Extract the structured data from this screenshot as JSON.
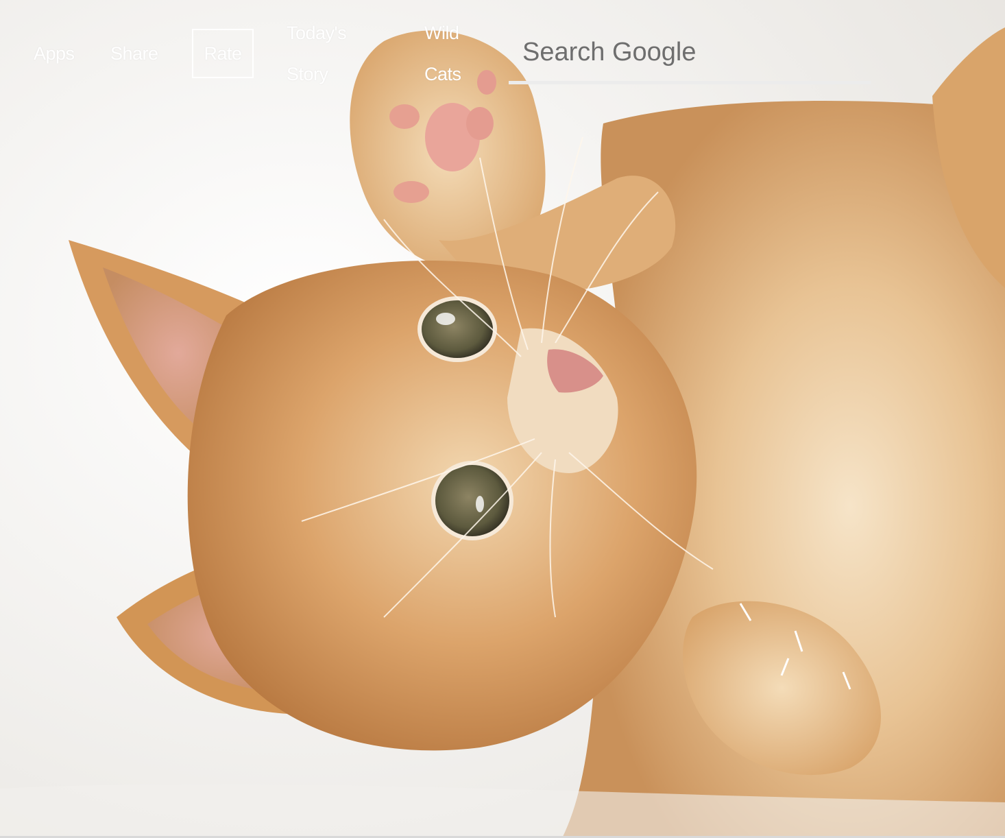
{
  "nav": {
    "apps_label": "Apps",
    "share_label": "Share",
    "rate_label": "Rate",
    "todays_story": {
      "line1": "Today's",
      "line2": "Story"
    },
    "wild_cats": {
      "line1": "Wild",
      "line2": "Cats"
    }
  },
  "search": {
    "placeholder": "Search Google",
    "value": ""
  },
  "background": {
    "subject": "kitten-photo",
    "colors": {
      "backdrop": "#f3f1ee",
      "fur_light": "#e9c79d",
      "fur_mid": "#d7a36a",
      "fur_dark": "#b9783f",
      "eye": "#6f6a4b"
    }
  },
  "theme": {
    "nav_text_color": "#ffffff",
    "search_text_color": "#6e6e6e",
    "search_underline_color": "#ececec"
  }
}
